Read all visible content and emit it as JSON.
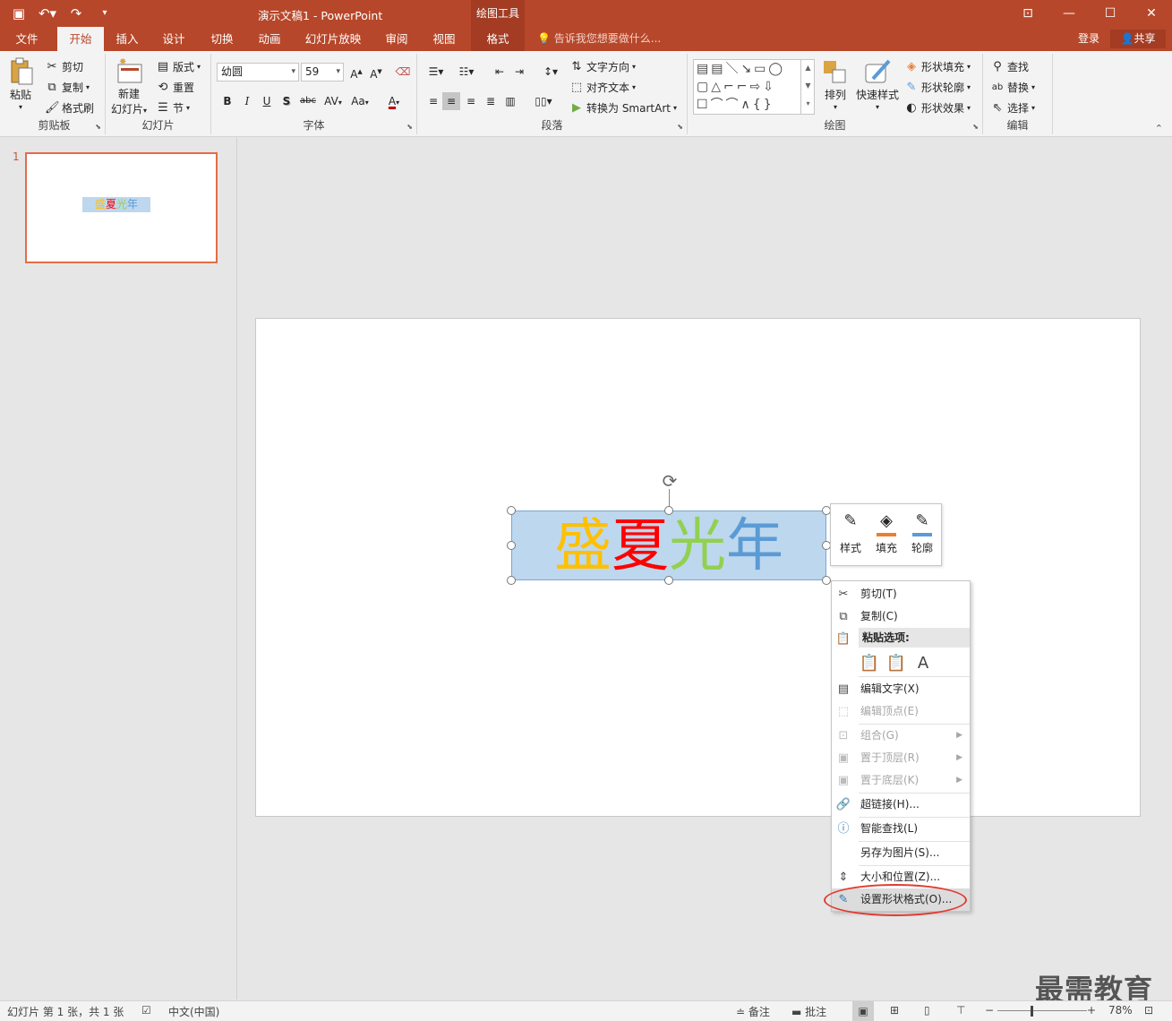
{
  "titlebar": {
    "title": "演示文稿1 - PowerPoint",
    "context_tab_group": "绘图工具",
    "qat": {
      "save_icon": "save-icon",
      "undo_icon": "undo-icon",
      "redo_icon": "redo-icon"
    }
  },
  "tabs": {
    "items": [
      "文件",
      "开始",
      "插入",
      "设计",
      "切换",
      "动画",
      "幻灯片放映",
      "审阅",
      "视图",
      "格式"
    ],
    "active": "开始",
    "tell_me": "告诉我您想要做什么...",
    "login": "登录",
    "share": "共享"
  },
  "ribbon": {
    "clipboard": {
      "label": "剪贴板",
      "paste": "粘贴",
      "cut": "剪切",
      "copy": "复制",
      "format_painter": "格式刷"
    },
    "slides": {
      "label": "幻灯片",
      "new_slide_line1": "新建",
      "new_slide_line2": "幻灯片",
      "layout": "版式",
      "reset": "重置",
      "section": "节"
    },
    "font": {
      "label": "字体",
      "font_name": "幼圆",
      "font_size": "59",
      "bold": "B",
      "italic": "I",
      "underline": "U",
      "shadow": "S",
      "strike": "abc",
      "spacing": "AV",
      "case": "Aa",
      "color": "A"
    },
    "paragraph": {
      "label": "段落",
      "text_direction": "文字方向",
      "align_text": "对齐文本",
      "smartart": "转换为 SmartArt"
    },
    "drawing": {
      "label": "绘图",
      "arrange": "排列",
      "quick_styles": "快速样式",
      "shape_fill": "形状填充",
      "shape_outline": "形状轮廓",
      "shape_effects": "形状效果"
    },
    "editing": {
      "label": "编辑",
      "find": "查找",
      "replace": "替换",
      "select": "选择"
    }
  },
  "slides_pane": {
    "slide_number": "1",
    "thumb_text": "盛夏光年"
  },
  "slide": {
    "text_chars": [
      {
        "char": "盛",
        "color": "#ffc000"
      },
      {
        "char": "夏",
        "color": "#ff0000"
      },
      {
        "char": "光",
        "color": "#92d050"
      },
      {
        "char": "年",
        "color": "#5b9bd5"
      }
    ],
    "shape_fill": "#bdd7ee"
  },
  "mini_toolbar": {
    "style": "样式",
    "fill": "填充",
    "outline": "轮廓",
    "fill_color": "#ed7d31",
    "outline_color": "#5b9bd5"
  },
  "context_menu": {
    "cut": "剪切(T)",
    "copy": "复制(C)",
    "paste_options": "粘贴选项:",
    "edit_text": "编辑文字(X)",
    "edit_points": "编辑顶点(E)",
    "group": "组合(G)",
    "bring_front": "置于顶层(R)",
    "send_back": "置于底层(K)",
    "hyperlink": "超链接(H)...",
    "smart_lookup": "智能查找(L)",
    "save_as_picture": "另存为图片(S)...",
    "size_position": "大小和位置(Z)...",
    "format_shape": "设置形状格式(O)..."
  },
  "statusbar": {
    "slide_info": "幻灯片 第 1 张，共 1 张",
    "language": "中文(中国)",
    "notes": "备注",
    "comments": "批注",
    "zoom": "78%"
  },
  "watermark": "最需教育"
}
